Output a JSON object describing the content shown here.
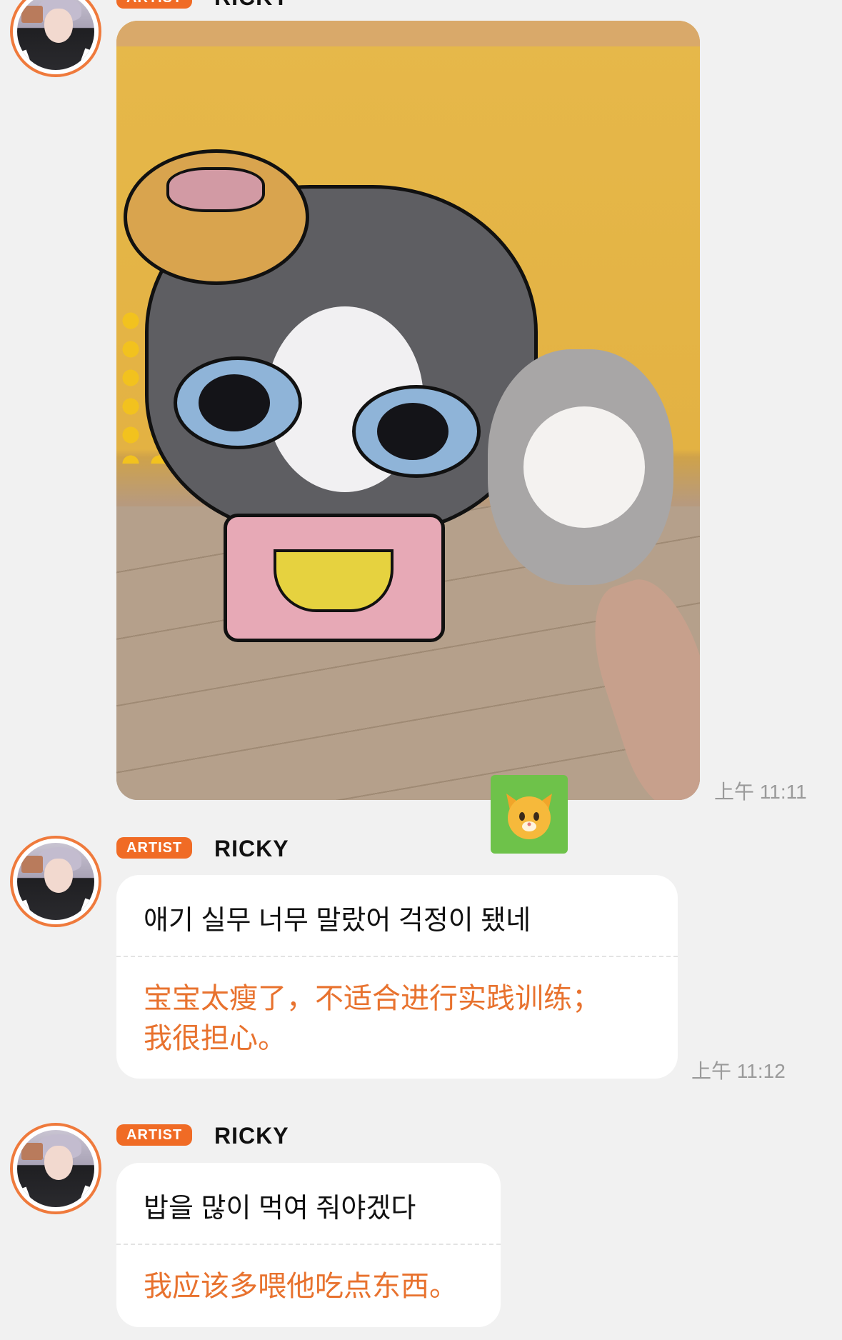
{
  "messages": [
    {
      "badge": "ARTIST",
      "name": "RICKY",
      "type": "image",
      "image_description": "",
      "time": "上午 11:11"
    },
    {
      "badge": "ARTIST",
      "name": "RICKY",
      "type": "text",
      "original": "애기 실무 너무 말랐어 걱정이 됐네",
      "translation_line1": "宝宝太瘦了，不适合进行实践训练；",
      "translation_line2": "我很担心。",
      "time": "上午 11:12"
    },
    {
      "badge": "ARTIST",
      "name": "RICKY",
      "type": "text",
      "original": "밥을 많이 먹여 줘야겠다",
      "translation_line1": "我应该多喂他吃点东西。",
      "time": ""
    }
  ],
  "reaction_sticker": {
    "icon": "cat-face-icon",
    "background": "#6ec24a"
  },
  "colors": {
    "accent": "#f06b25",
    "translation": "#e8722e",
    "timestamp": "#9a9a9a",
    "background": "#f1f1f1"
  }
}
